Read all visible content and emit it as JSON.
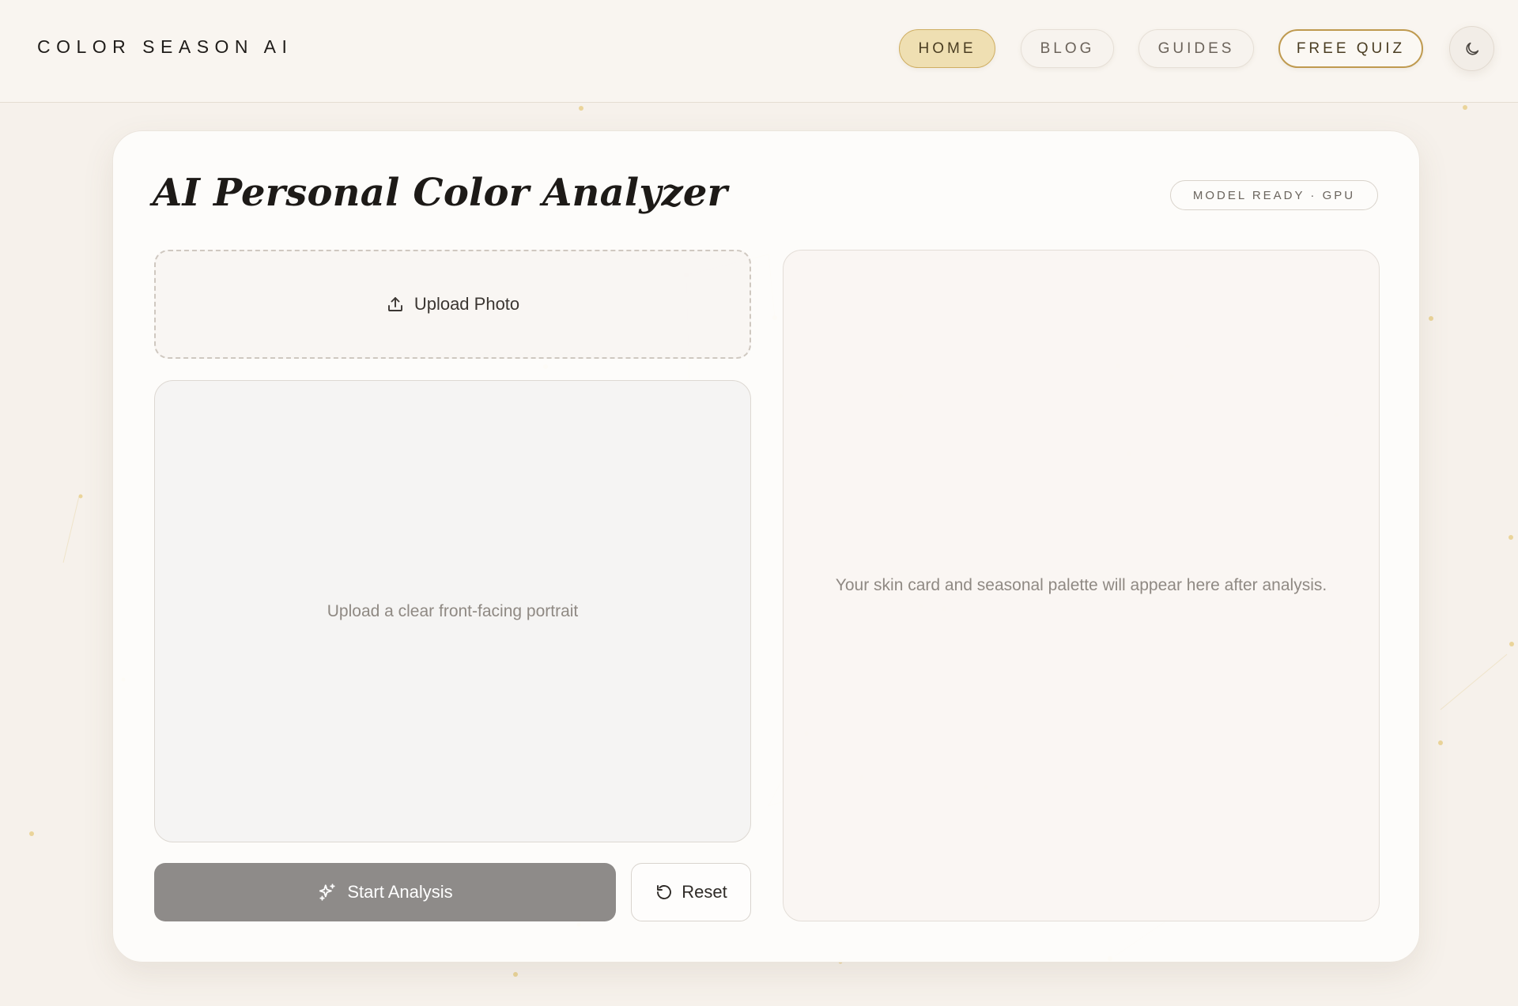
{
  "header": {
    "brand": "COLOR SEASON AI",
    "nav": [
      {
        "label": "HOME",
        "active": true
      },
      {
        "label": "BLOG",
        "active": false
      },
      {
        "label": "GUIDES",
        "active": false
      },
      {
        "label": "FREE QUIZ",
        "active": false
      }
    ],
    "theme_toggle_icon": "moon-icon"
  },
  "analyzer": {
    "title": "AI Personal Color Analyzer",
    "status_badge": "MODEL READY · GPU",
    "upload_label": "Upload Photo",
    "upload_icon": "upload-icon",
    "preview_hint": "Upload a clear front-facing portrait",
    "start_label": "Start Analysis",
    "start_icon": "sparkles-icon",
    "reset_label": "Reset",
    "reset_icon": "reset-icon",
    "result_hint": "Your skin card and seasonal palette will appear here after analysis."
  },
  "colors": {
    "accent_gold": "#cfae62",
    "active_pill_bg": "#efdfb2",
    "start_button_bg": "#8e8b89",
    "page_bg": "#f6f1eb"
  }
}
